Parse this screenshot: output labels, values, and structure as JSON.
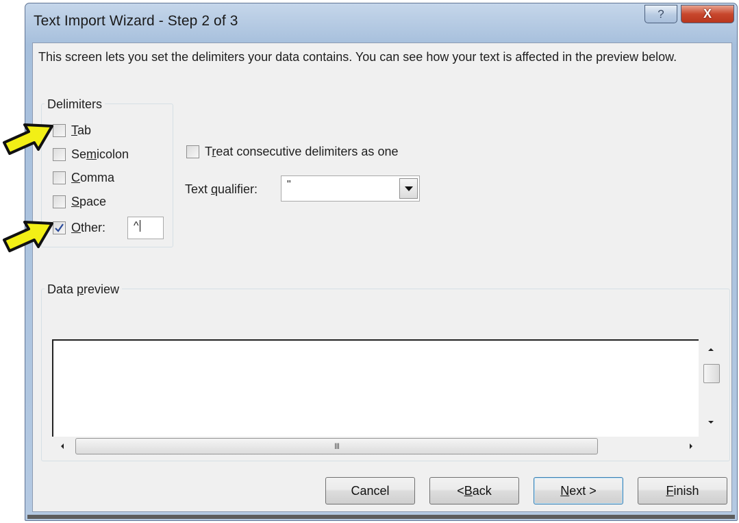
{
  "window": {
    "title": "Text Import Wizard - Step 2 of 3",
    "help_label": "?",
    "close_label": "X"
  },
  "description": "This screen lets you set the delimiters your data contains.  You can see how your text is affected in the preview below.",
  "delimiters": {
    "legend": "Delimiters",
    "items": [
      {
        "pre": "",
        "key": "T",
        "post": "ab",
        "checked": false
      },
      {
        "pre": "Se",
        "key": "m",
        "post": "icolon",
        "checked": false
      },
      {
        "pre": "",
        "key": "C",
        "post": "omma",
        "checked": false
      },
      {
        "pre": "",
        "key": "S",
        "post": "pace",
        "checked": false
      },
      {
        "pre": "",
        "key": "O",
        "post": "ther:",
        "checked": true
      }
    ],
    "other_value": "^"
  },
  "options": {
    "consecutive": {
      "pre": "T",
      "key": "r",
      "post": "eat consecutive delimiters as one",
      "checked": false
    },
    "qualifier_label": {
      "pre": "Text ",
      "key": "q",
      "post": "ualifier:"
    },
    "qualifier_value": "\""
  },
  "preview": {
    "legend_pre": "Data ",
    "legend_key": "p",
    "legend_post": "review",
    "hscroll_grip": "III"
  },
  "buttons": {
    "cancel": "Cancel",
    "back_pre": "< ",
    "back_key": "B",
    "back_post": "ack",
    "next_key": "N",
    "next_post": "ext >",
    "finish_key": "F",
    "finish_post": "inish"
  },
  "colors": {
    "arrow_fill": "#f2ef16",
    "check_mark": "#2a4a9a"
  }
}
